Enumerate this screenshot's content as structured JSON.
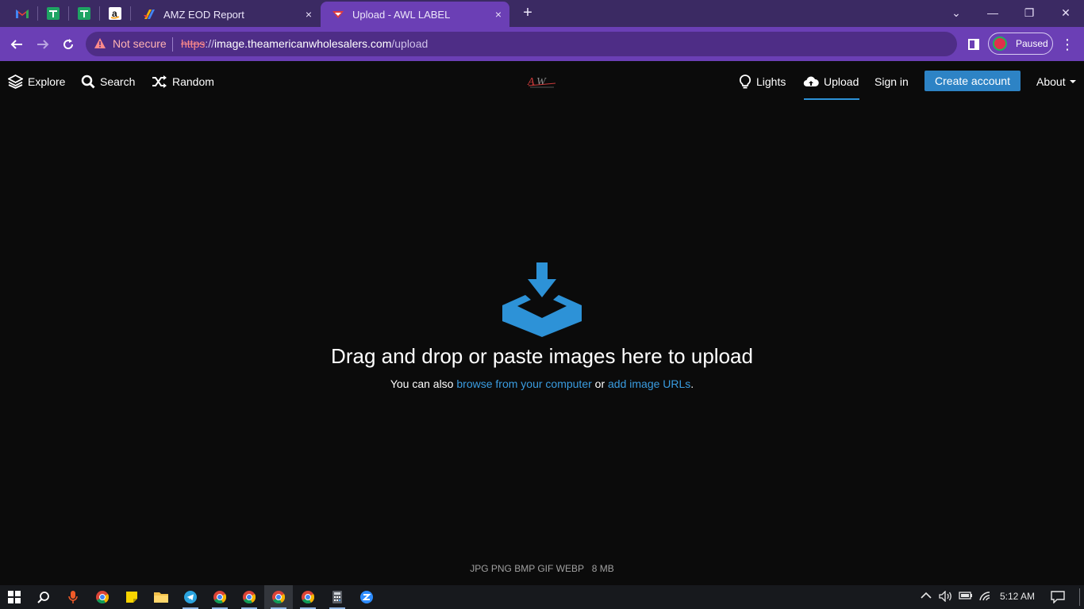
{
  "browser": {
    "tabs": [
      {
        "title": "AMZ EOD Report",
        "active": false
      },
      {
        "title": "Upload - AWL LABEL",
        "active": true
      }
    ],
    "new_tab_symbol": "+",
    "close_symbol": "×",
    "omnibox": {
      "security_text": "Not secure",
      "url_scheme": "https",
      "url_host": "image.theamericanwholesalers.com",
      "url_path": "/upload"
    },
    "profile_status": "Paused",
    "window_controls": {
      "chevron": "⌄",
      "minimize": "—",
      "restore": "❐",
      "close": "✕"
    }
  },
  "site": {
    "nav_left": [
      {
        "label": "Explore",
        "icon": "layers-icon"
      },
      {
        "label": "Search",
        "icon": "search-icon"
      },
      {
        "label": "Random",
        "icon": "shuffle-icon"
      }
    ],
    "nav_right": {
      "lights": "Lights",
      "upload": "Upload",
      "signin": "Sign in",
      "create": "Create account",
      "about": "About"
    },
    "upload": {
      "headline": "Drag and drop or paste images here to upload",
      "prefix": "You can also",
      "browse_link": "browse from your computer",
      "or": "or",
      "urls_link": "add image URLs",
      "suffix": ".",
      "formats": "JPG PNG BMP GIF WEBP   8 MB"
    },
    "accent_color": "#2d92d7"
  },
  "taskbar": {
    "time": "5:12 AM"
  }
}
